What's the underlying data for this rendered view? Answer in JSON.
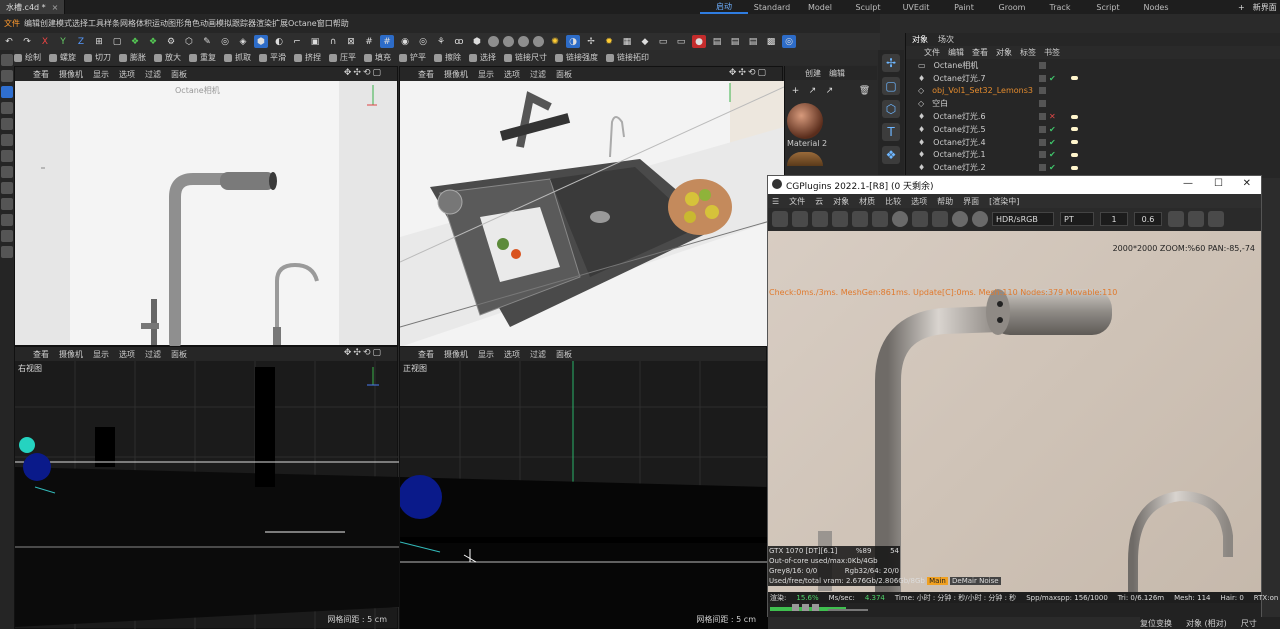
{
  "app": {
    "file_tab": "文件",
    "doc_title": "水槽.c4d *",
    "menus": [
      "编辑",
      "创建",
      "模式",
      "选择",
      "工具",
      "样条",
      "网格",
      "体积",
      "运动图形",
      "角色",
      "动画",
      "模拟",
      "跟踪器",
      "渲染",
      "扩展",
      "Octane",
      "窗口",
      "帮助"
    ],
    "active_menu_index": 4,
    "layouts": [
      "启动",
      "Standard",
      "Model",
      "Sculpt",
      "UVEdit",
      "Paint",
      "Groom",
      "Track",
      "Script",
      "Nodes"
    ],
    "active_layout_index": 0,
    "new_layout": "新界面"
  },
  "toolbar1": {
    "axes": [
      "X",
      "Y",
      "Z"
    ]
  },
  "toolbar2": {
    "items": [
      "绘制",
      "螺旋",
      "切刀",
      "膨胀",
      "放大",
      "重复",
      "抓取",
      "平滑",
      "挤捏",
      "压平",
      "填充",
      "铲平",
      "擦除",
      "选择",
      "链接尺寸",
      "链接强度",
      "链接拓印"
    ]
  },
  "viewports": [
    {
      "menus": [
        "查看",
        "摄像机",
        "显示",
        "选项",
        "过滤",
        "面板"
      ],
      "label": "Octane相机",
      "grid": ""
    },
    {
      "menus": [
        "查看",
        "摄像机",
        "显示",
        "选项",
        "过滤",
        "面板"
      ],
      "label": "",
      "grid": ""
    },
    {
      "menus": [
        "查看",
        "摄像机",
        "显示",
        "选项",
        "过滤",
        "面板"
      ],
      "label": "右视图",
      "grid": "网格间距 : 5 cm"
    },
    {
      "menus": [
        "查看",
        "摄像机",
        "显示",
        "选项",
        "过滤",
        "面板"
      ],
      "label": "正视图",
      "grid": "网格间距 : 5 cm"
    }
  ],
  "material_panel": {
    "menus": [
      "创建",
      "编辑"
    ],
    "material_name": "Material 2"
  },
  "object_manager": {
    "tabs": [
      "对象",
      "场次"
    ],
    "menus": [
      "文件",
      "编辑",
      "查看",
      "对象",
      "标签",
      "书签"
    ],
    "objects": [
      {
        "name": "Octane相机",
        "icon": "camera-icon",
        "tag": "",
        "highlight": false
      },
      {
        "name": "Octane灯光.7",
        "icon": "light-icon",
        "tag": "check",
        "highlight": false
      },
      {
        "name": "obj_Vol1_Set32_Lemons3",
        "icon": "null-icon",
        "tag": "",
        "highlight": true
      },
      {
        "name": "空白",
        "icon": "null-icon",
        "tag": "",
        "highlight": false
      },
      {
        "name": "Octane灯光.6",
        "icon": "light-icon",
        "tag": "x",
        "highlight": false
      },
      {
        "name": "Octane灯光.5",
        "icon": "light-icon",
        "tag": "check",
        "highlight": false
      },
      {
        "name": "Octane灯光.4",
        "icon": "light-icon",
        "tag": "check",
        "highlight": false
      },
      {
        "name": "Octane灯光.1",
        "icon": "light-icon",
        "tag": "check",
        "highlight": false
      },
      {
        "name": "Octane灯光.2",
        "icon": "light-icon",
        "tag": "check",
        "highlight": false
      }
    ]
  },
  "octane": {
    "title": "CGPlugins  2022.1-[R8] (0 天剩余)",
    "window_controls": [
      "—",
      "☐",
      "✕"
    ],
    "menus": [
      "文件",
      "云",
      "对象",
      "材质",
      "比较",
      "选项",
      "帮助",
      "界面",
      "[渲染中]"
    ],
    "colorspace": "HDR/sRGB",
    "kernel": "PT",
    "field1": "1",
    "field2": "0.6",
    "stats": "Check:0ms./3ms. MeshGen:861ms. Update[C]:0ms. Mesh:110 Nodes:379 Movable:110",
    "zoom_info": "2000*2000 ZOOM:%60  PAN:-85,-74",
    "hud": {
      "gpu": "GTX 1070 [DT][6.1]",
      "gpu_pct": "%89",
      "gpu_temp": "54",
      "outofcore": "Out-of-core used/max:0Kb/4Gb",
      "grey": "Grey8/16: 0/0",
      "rgb": "Rgb32/64: 20/0",
      "vram": "Used/free/total vram: 2.676Gb/2.806Gb/8Gb",
      "main": "Main",
      "denoise": "DeMair Noise"
    },
    "bottom": {
      "render_label": "渲染:",
      "render_pct": "15.6%",
      "ms_label": "Ms/sec:",
      "ms_val": "4.374",
      "time": "Time: 小时 : 分钟 : 秒/小时 : 分钟 : 秒",
      "spp": "Spp/maxspp: 156/1000",
      "tri": "Tri: 0/6.126m",
      "mesh": "Mesh: 114",
      "hair": "Hair: 0",
      "rtx": "RTX:on"
    },
    "progress_percent": 15.6
  },
  "status": {
    "items": [
      "复位变换",
      "对象 (相对)",
      "尺寸"
    ]
  }
}
